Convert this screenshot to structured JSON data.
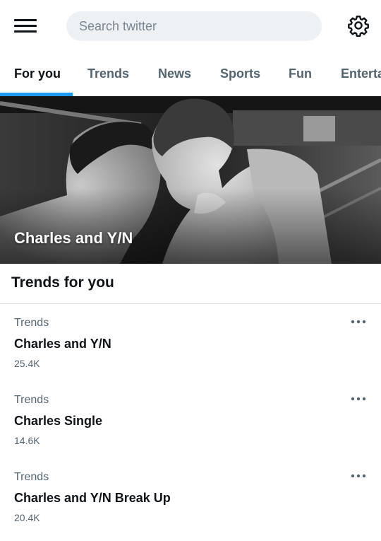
{
  "search": {
    "placeholder": "Search twitter"
  },
  "tabs": [
    {
      "label": "For you",
      "active": true
    },
    {
      "label": "Trends"
    },
    {
      "label": "News"
    },
    {
      "label": "Sports"
    },
    {
      "label": "Fun"
    },
    {
      "label": "Entertainment"
    }
  ],
  "accent_color": "#1d9bf0",
  "hero": {
    "title": "Charles and Y/N"
  },
  "section": {
    "title": "Trends for you"
  },
  "trends": [
    {
      "category": "Trends",
      "name": "Charles and Y/N",
      "count": "25.4K"
    },
    {
      "category": "Trends",
      "name": "Charles Single",
      "count": "14.6K"
    },
    {
      "category": "Trends",
      "name": "Charles and Y/N Break Up",
      "count": "20.4K"
    }
  ],
  "icons": [
    "menu-icon",
    "gear-icon",
    "more-icon"
  ]
}
